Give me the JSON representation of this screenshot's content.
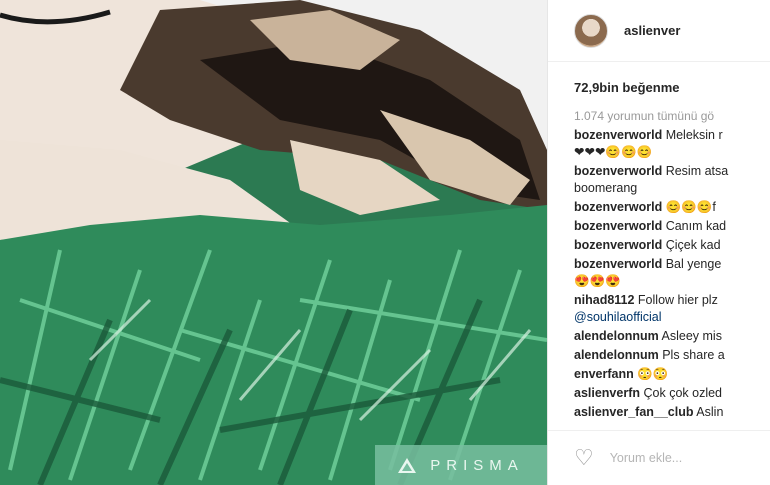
{
  "post": {
    "watermark_label": "PRISMA"
  },
  "profile": {
    "username": "aslienver"
  },
  "likes_text": "72,9bin beğenme",
  "view_all_text": "1.074 yorumun tümünü gö",
  "comments": [
    {
      "user": "bozenverworld",
      "text": " Meleksin r",
      "extra": "❤❤❤😊😊😊"
    },
    {
      "user": "bozenverworld",
      "text": " Resim atsa",
      "extra": "boomerang"
    },
    {
      "user": "bozenverworld",
      "text": " 😊😊😊f"
    },
    {
      "user": "bozenverworld",
      "text": " Canım kad"
    },
    {
      "user": "bozenverworld",
      "text": " Çiçek kad"
    },
    {
      "user": "bozenverworld",
      "text": " Bal yenge",
      "extra": "😍😍😍"
    },
    {
      "user": "nihad8112",
      "text": " Follow hier plz",
      "mention": "@souhilaofficial"
    },
    {
      "user": "alendelonnum",
      "text": " Asleey mis"
    },
    {
      "user": "alendelonnum",
      "text": " Pls share a"
    },
    {
      "user": "enverfann",
      "text": " 😳😳"
    },
    {
      "user": "aslienverfn",
      "text": " Çok çok ozled"
    },
    {
      "user": "aslienver_fan__club",
      "text": " Aslin"
    }
  ],
  "composer": {
    "placeholder": "Yorum ekle..."
  },
  "icons": {
    "like": "heart-outline-icon",
    "prisma": "prisma-triangle-icon"
  },
  "colors": {
    "mention": "#003569",
    "prisma_bg": "#78bea0"
  }
}
